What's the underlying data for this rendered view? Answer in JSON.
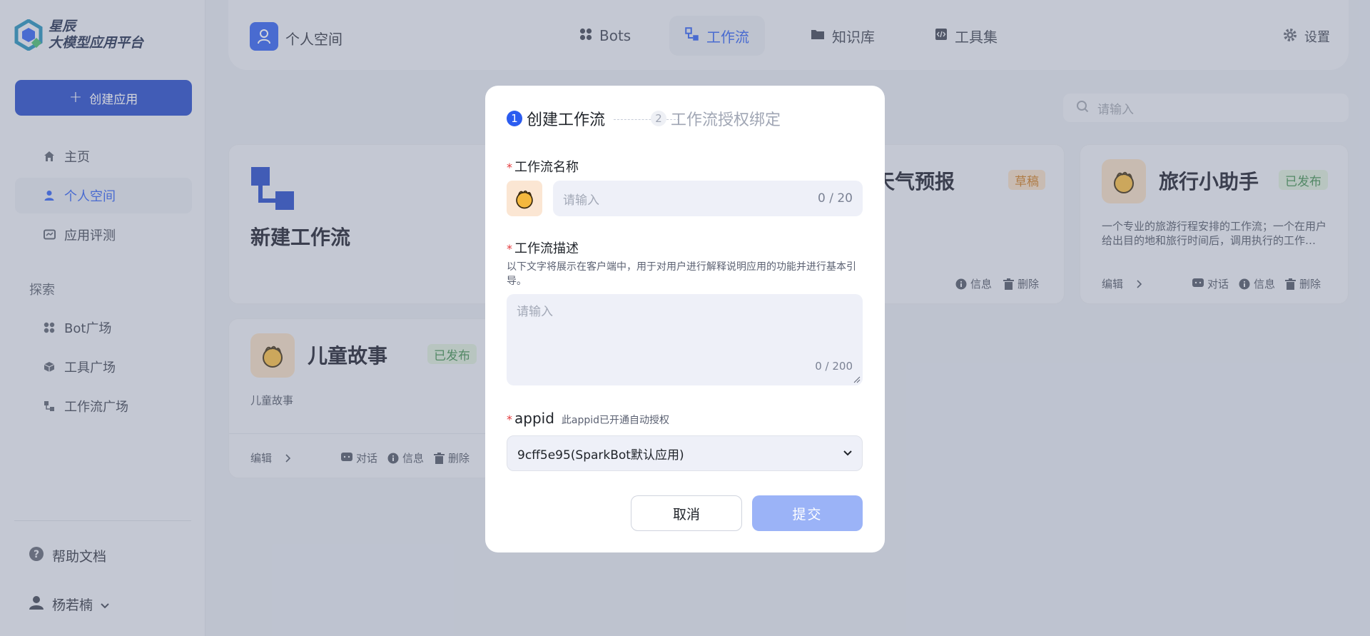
{
  "brand": {
    "line1": "星辰",
    "line2": "大模型应用平台"
  },
  "sidebar": {
    "create_label": "创建应用",
    "nav": [
      {
        "label": "主页",
        "icon": "home-icon"
      },
      {
        "label": "个人空间",
        "icon": "user-icon"
      },
      {
        "label": "应用评测",
        "icon": "evaluate-icon"
      }
    ],
    "explore_label": "探索",
    "explore": [
      {
        "label": "Bot广场",
        "icon": "grid-icon"
      },
      {
        "label": "工具广场",
        "icon": "cube-icon"
      },
      {
        "label": "工作流广场",
        "icon": "workflow-icon"
      }
    ],
    "help_label": "帮助文档",
    "user_name": "杨若楠"
  },
  "topbar": {
    "space_label": "个人空间",
    "tabs": [
      "Bots",
      "工作流",
      "知识库",
      "工具集"
    ],
    "settings_label": "设置"
  },
  "search": {
    "placeholder": "请输入"
  },
  "cards": {
    "new_label": "新建工作流",
    "weather": {
      "title": "天气预报",
      "status": "草稿",
      "info": "信息",
      "delete": "删除"
    },
    "travel": {
      "title": "旅行小助手",
      "status": "已发布",
      "desc": "一个专业的旅游行程安排的工作流；一个在用户给出目的地和旅行时间后，调用执行的工作…",
      "edit": "编辑",
      "chat": "对话",
      "info": "信息",
      "delete": "删除"
    },
    "story": {
      "title": "儿童故事",
      "status": "已发布",
      "desc": "儿童故事",
      "edit": "编辑",
      "chat": "对话",
      "info": "信息",
      "delete": "删除"
    }
  },
  "modal": {
    "step1_num": "1",
    "step1_label": "创建工作流",
    "step2_num": "2",
    "step2_label": "工作流授权绑定",
    "name_label": "工作流名称",
    "name_placeholder": "请输入",
    "name_count": "0 / 20",
    "desc_label": "工作流描述",
    "desc_hint": "以下文字将展示在客户端中，用于对用户进行解释说明应用的功能并进行基本引导。",
    "desc_placeholder": "请输入",
    "desc_count": "0 / 200",
    "appid_label": "appid",
    "appid_hint": "此appid已开通自动授权",
    "appid_value": "9cff5e95(SparkBot默认应用)",
    "cancel_label": "取消",
    "submit_label": "提交"
  },
  "colors": {
    "primary": "#2b5cf0",
    "brand_button": "#1f45c8",
    "submit_disabled": "#9bb3f7",
    "published": "#3b8a4e",
    "draft": "#c8771e"
  }
}
